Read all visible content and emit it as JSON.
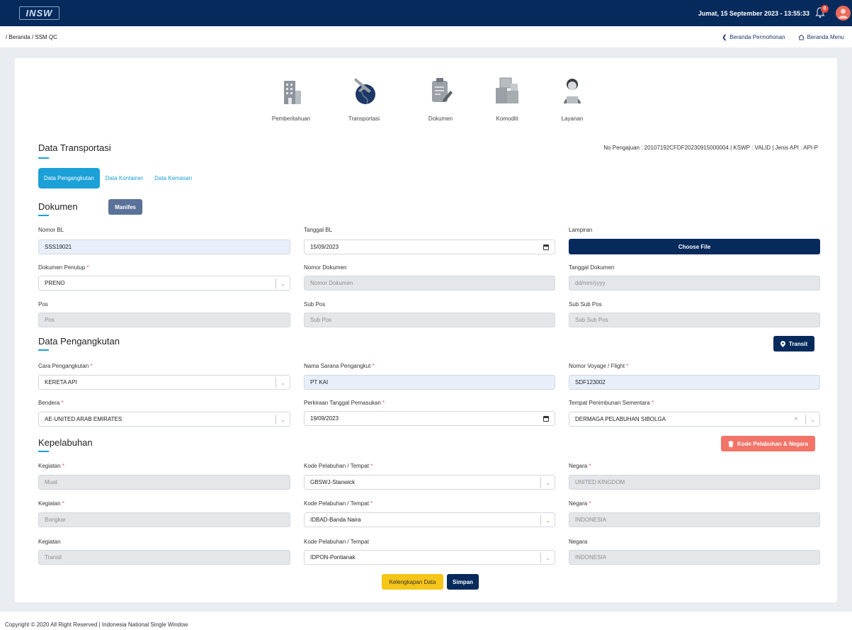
{
  "header": {
    "logo_text": "INSW",
    "datetime": "Jumat, 15 September 2023 - 13:55:33",
    "notif_count": "0",
    "colors": {
      "brand": "#072a5c",
      "accent": "#1ba0d8",
      "active_step": "#f27468"
    }
  },
  "breadcrumb": "/ Beranda / SSM QC",
  "nav": {
    "back": "Beranda Permohonan",
    "home": "Beranda Menu"
  },
  "steps": [
    {
      "label": "Pemberitahuan",
      "icon": "building-icon"
    },
    {
      "label": "Transportasi",
      "icon": "globe-plane-icon"
    },
    {
      "label": "Dokumen",
      "icon": "document-icon"
    },
    {
      "label": "Komoditi",
      "icon": "boxes-icon"
    },
    {
      "label": "Layanan",
      "icon": "customer-service-icon"
    }
  ],
  "page_title": "Data Transportasi",
  "pengajuan_info": "No Pengajuan : 20107192CFDF20230915000004 | KSWP : VALID | Jenis API : API-P",
  "tabs": [
    "Data Pengangkutan",
    "Data Kontainer",
    "Data Kemasan"
  ],
  "dokumen": {
    "title": "Dokumen",
    "manifes_btn": "Manifes",
    "nomor_bl": {
      "label": "Nomor BL",
      "value": "SSS19021"
    },
    "tanggal_bl": {
      "label": "Tanggal BL",
      "value": "15/09/2023"
    },
    "lampiran": {
      "label": "Lampiran",
      "button": "Choose File"
    },
    "dokumen_penutup": {
      "label": "Dokumen Penutup",
      "value": "PRENO"
    },
    "nomor_dokumen": {
      "label": "Nomor Dokumen",
      "placeholder": "Nomor Dokumen"
    },
    "tanggal_dokumen": {
      "label": "Tanggal Dokumen",
      "placeholder": "dd/mm/yyyy"
    },
    "pos": {
      "label": "Pos",
      "placeholder": "Pos"
    },
    "sub_pos": {
      "label": "Sub Pos",
      "placeholder": "Sub Pos"
    },
    "sub_sub_pos": {
      "label": "Sub Sub Pos",
      "placeholder": "Sub Sub Pos"
    }
  },
  "pengangkutan": {
    "title": "Data Pengangkutan",
    "transit_btn": "Transit",
    "cara": {
      "label": "Cara Pengangkutan",
      "value": "KERETA API"
    },
    "nama_sarana": {
      "label": "Nama Sarana Pengangkut",
      "value": "PT KAI"
    },
    "voyage": {
      "label": "Nomor Voyage / Flight",
      "value": "SDF123002"
    },
    "bendera": {
      "label": "Bendera",
      "value": "AE-UNITED ARAB EMIRATES"
    },
    "perkiraan": {
      "label": "Perkiraan Tanggal Pemasukan",
      "value": "19/09/2023"
    },
    "tempat": {
      "label": "Tempat Penimbunan Sementara",
      "value": "DERMAGA PELABUHAN SIBOLGA"
    }
  },
  "kepelabuhan": {
    "title": "Kepelabuhan",
    "kode_btn": "Kode Pelabuhan & Negara",
    "rows": [
      {
        "kegiatan_label": "Kegiatan",
        "required": true,
        "kegiatan": "Muat",
        "kode_label": "Kode Pelabuhan / Tempat",
        "kode": "GBSWJ-Stanwick",
        "negara_label": "Negara",
        "negara": "UNITED KINGDOM"
      },
      {
        "kegiatan_label": "Kegiatan",
        "required": true,
        "kegiatan": "Bongkar",
        "kode_label": "Kode Pelabuhan / Tempat",
        "kode": "IDBAD-Banda Naira",
        "negara_label": "Negara",
        "negara": "INDONESIA"
      },
      {
        "kegiatan_label": "Kegiatan",
        "required": false,
        "kegiatan": "Transit",
        "kode_label": "Kode Pelabuhan / Tempat",
        "kode": "IDPON-Pontianak",
        "negara_label": "Negara",
        "negara": "INDONESIA"
      }
    ]
  },
  "actions": {
    "kelengkapan": "Kelengkapan Data",
    "simpan": "Simpan"
  },
  "footer": "Copyright © 2020 All Right Reserved | Indonesia National Single Window"
}
